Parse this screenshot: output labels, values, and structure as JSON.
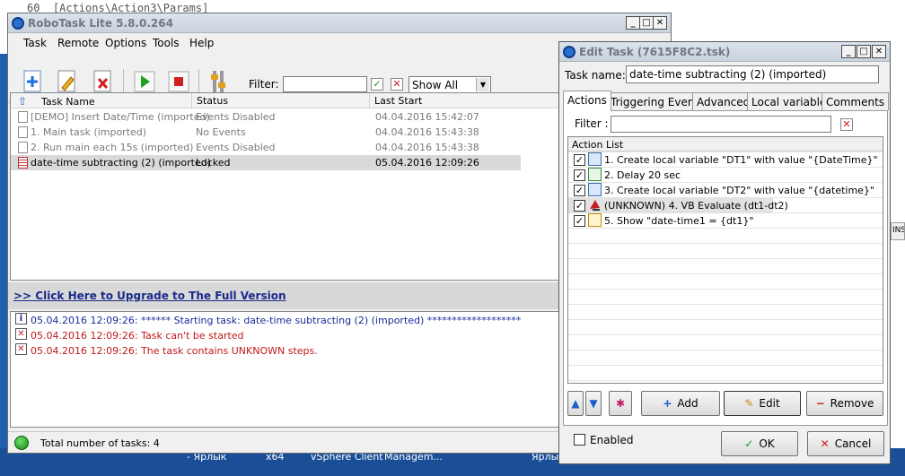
{
  "background": {
    "editor_line_no": "60",
    "editor_line_text": "[Actions\\Action3\\Params]",
    "right_fragment": "INS",
    "taskbar": [
      "- Ярлык",
      "x64",
      "vSphere Client",
      "Managem...",
      "Ярлык"
    ]
  },
  "main": {
    "title": "RoboTask Lite 5.8.0.264",
    "menu": [
      "Task",
      "Remote",
      "Options",
      "Tools",
      "Help"
    ],
    "filter_label": "Filter:",
    "filter_value": "",
    "show_select": "Show All",
    "columns": [
      "Task Name",
      "Status",
      "Last Start"
    ],
    "tasks": [
      {
        "name": "[DEMO] Insert Date/Time (imported)",
        "status": "Events Disabled",
        "last_start": "04.04.2016 15:42:07"
      },
      {
        "name": "1. Main task (imported)",
        "status": "No Events",
        "last_start": "04.04.2016 15:43:38"
      },
      {
        "name": "2. Run main each 15s (imported)",
        "status": "Events Disabled",
        "last_start": "04.04.2016 15:43:38"
      },
      {
        "name": "date-time subtracting (2) (imported)",
        "status": "Locked",
        "last_start": "05.04.2016 12:09:26"
      }
    ],
    "upgrade_link": ">> Click Here to Upgrade to The Full Version",
    "log": [
      {
        "type": "info",
        "text": "05.04.2016 12:09:26: ****** Starting task: date-time subtracting (2) (imported) *******************"
      },
      {
        "type": "error",
        "text": "05.04.2016 12:09:26: Task can't be started"
      },
      {
        "type": "error",
        "text": "05.04.2016 12:09:26: The task contains UNKNOWN steps."
      }
    ],
    "status_text": "Total number of tasks: 4"
  },
  "edit": {
    "title": "Edit Task (7615F8C2.tsk)",
    "task_name_label": "Task name:",
    "task_name_value": "date-time subtracting (2) (imported)",
    "tabs": [
      "Actions",
      "Triggering Events",
      "Advanced",
      "Local variables",
      "Comments"
    ],
    "filter_label": "Filter :",
    "filter_value": "",
    "action_list_header": "Action List",
    "actions": [
      "1. Create local variable \"DT1\" with value \"{DateTime}\"",
      "2. Delay 20 sec",
      "3. Create local variable \"DT2\" with value \"{datetime}\"",
      "(UNKNOWN) 4. VB Evaluate (dt1-dt2)",
      "5. Show \"date-time1  = {dt1}\""
    ],
    "add_label": "Add",
    "edit_label": "Edit",
    "remove_label": "Remove",
    "enabled_label": "Enabled",
    "ok_label": "OK",
    "cancel_label": "Cancel"
  }
}
